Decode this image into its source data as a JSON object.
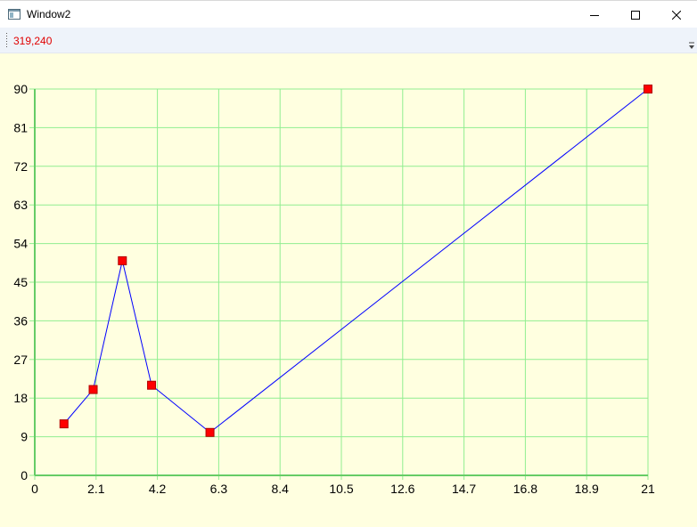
{
  "window": {
    "title": "Window2"
  },
  "toolbar": {
    "coordinate_readout": "319,240"
  },
  "colors": {
    "plot_background": "#ffffe0",
    "grid": "#90ee90",
    "line": "#0000ff",
    "marker": "#ff0000",
    "coordinate_text": "#e00000"
  },
  "icons": [
    "app-window-icon",
    "minimize-icon",
    "maximize-icon",
    "close-icon",
    "toolbar-grip-icon",
    "toolbar-overflow-icon"
  ],
  "chart_data": {
    "type": "line",
    "title": "",
    "xlabel": "",
    "ylabel": "",
    "xlim": [
      0,
      21
    ],
    "ylim": [
      0,
      90
    ],
    "grid": true,
    "x_ticks": [
      0,
      2.1,
      4.2,
      6.3,
      8.4,
      10.5,
      12.6,
      14.7,
      16.8,
      18.9,
      21
    ],
    "y_ticks": [
      0,
      9,
      18,
      27,
      36,
      45,
      54,
      63,
      72,
      81,
      90
    ],
    "series": [
      {
        "x": [
          1,
          2,
          3,
          4,
          6,
          21
        ],
        "y": [
          12,
          20,
          50,
          21,
          10,
          90
        ],
        "marker": "square"
      }
    ]
  }
}
